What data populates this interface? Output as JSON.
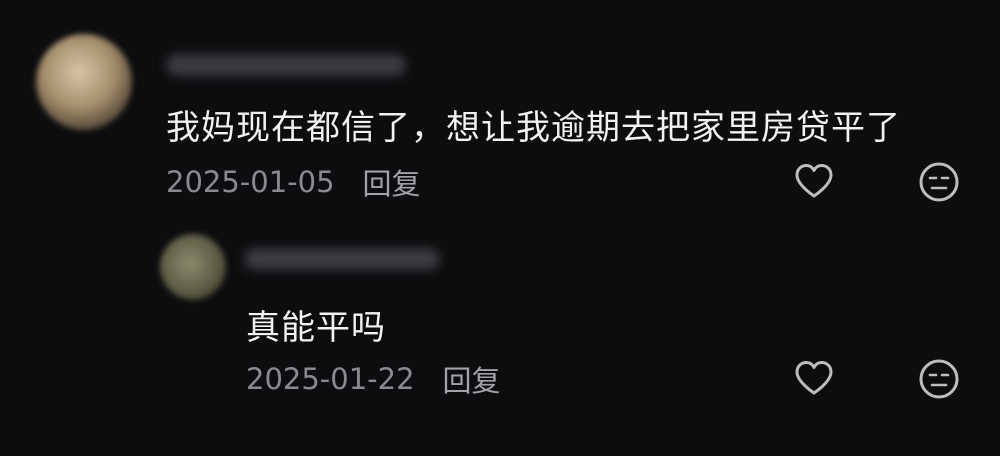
{
  "comments": [
    {
      "text": "我妈现在都信了，想让我逾期去把家里房贷平了",
      "date": "2025-01-05",
      "reply_label": "回复",
      "icons": {
        "like": "heart-icon",
        "react": "neutral-face-icon"
      }
    },
    {
      "text": "真能平吗",
      "date": "2025-01-22",
      "reply_label": "回复",
      "icons": {
        "like": "heart-icon",
        "react": "neutral-face-icon"
      }
    }
  ],
  "colors": {
    "background": "#0d0d0f",
    "text": "#f2f2f2",
    "meta": "#8a8a8e",
    "icon": "#bdbdc0"
  }
}
